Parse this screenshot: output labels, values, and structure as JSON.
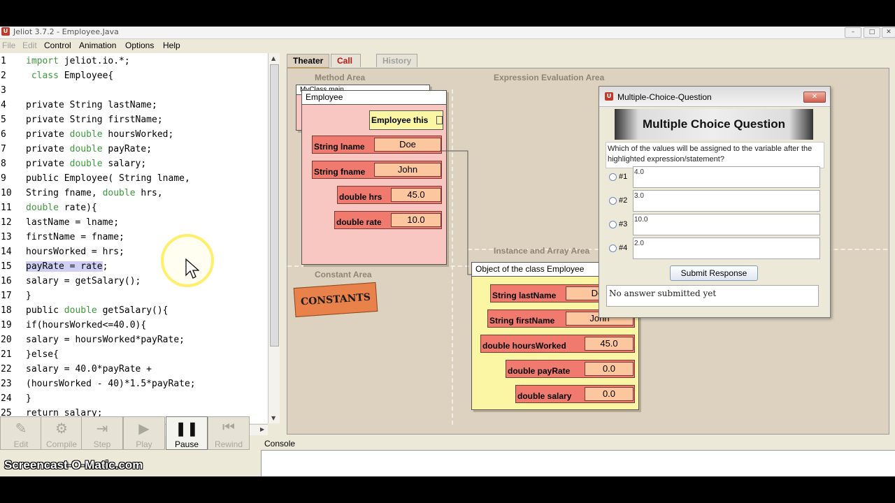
{
  "window": {
    "title": "Jeliot 3.7.2 - Employee.Java",
    "logo": "U",
    "controls": [
      "–",
      "□",
      "✕"
    ]
  },
  "menu": {
    "items": [
      {
        "label": "File",
        "enabled": false
      },
      {
        "label": "Edit",
        "enabled": false
      },
      {
        "label": "Control",
        "enabled": true
      },
      {
        "label": "Animation",
        "enabled": true
      },
      {
        "label": "Options",
        "enabled": true
      },
      {
        "label": "Help",
        "enabled": true
      }
    ]
  },
  "editor": {
    "lines": [
      {
        "n": "1",
        "parts": [
          {
            "t": "import",
            "c": "kw"
          },
          {
            "t": " jeliot.io.*;"
          }
        ]
      },
      {
        "n": "2",
        "parts": [
          {
            "t": " "
          },
          {
            "t": "class",
            "c": "kw"
          },
          {
            "t": " Employee{"
          }
        ]
      },
      {
        "n": "3",
        "parts": [
          {
            "t": ""
          }
        ]
      },
      {
        "n": "4",
        "parts": [
          {
            "t": "private String lastName;"
          }
        ]
      },
      {
        "n": "5",
        "parts": [
          {
            "t": "private String firstName;"
          }
        ]
      },
      {
        "n": "6",
        "parts": [
          {
            "t": "private "
          },
          {
            "t": "double",
            "c": "kw"
          },
          {
            "t": " hoursWorked;"
          }
        ]
      },
      {
        "n": "7",
        "parts": [
          {
            "t": "private "
          },
          {
            "t": "double",
            "c": "kw"
          },
          {
            "t": " payRate;"
          }
        ]
      },
      {
        "n": "8",
        "parts": [
          {
            "t": "private "
          },
          {
            "t": "double",
            "c": "kw"
          },
          {
            "t": " salary;"
          }
        ]
      },
      {
        "n": "9",
        "parts": [
          {
            "t": "public Employee( String lname,"
          }
        ]
      },
      {
        "n": "10",
        "parts": [
          {
            "t": "String fname, "
          },
          {
            "t": "double",
            "c": "kw"
          },
          {
            "t": " hrs,"
          }
        ]
      },
      {
        "n": "11",
        "parts": [
          {
            "t": "double",
            "c": "kw"
          },
          {
            "t": " rate){"
          }
        ]
      },
      {
        "n": "12",
        "parts": [
          {
            "t": "lastName = lname;"
          }
        ]
      },
      {
        "n": "13",
        "parts": [
          {
            "t": "firstName = fname;"
          }
        ]
      },
      {
        "n": "14",
        "parts": [
          {
            "t": "hoursWorked = hrs;"
          }
        ]
      },
      {
        "n": "15",
        "parts": [
          {
            "t": "payRate = rate",
            "c": "hl"
          },
          {
            "t": ";"
          }
        ]
      },
      {
        "n": "16",
        "parts": [
          {
            "t": "salary = getSalary();"
          }
        ]
      },
      {
        "n": "17",
        "parts": [
          {
            "t": "}"
          }
        ]
      },
      {
        "n": "18",
        "parts": [
          {
            "t": "public "
          },
          {
            "t": "double",
            "c": "kw"
          },
          {
            "t": " getSalary(){"
          }
        ]
      },
      {
        "n": "19",
        "parts": [
          {
            "t": "if(hoursWorked<=40.0){"
          }
        ]
      },
      {
        "n": "20",
        "parts": [
          {
            "t": "salary = hoursWorked*payRate;"
          }
        ]
      },
      {
        "n": "21",
        "parts": [
          {
            "t": "}else{"
          }
        ]
      },
      {
        "n": "22",
        "parts": [
          {
            "t": "salary = 40.0*payRate +"
          }
        ]
      },
      {
        "n": "23",
        "parts": [
          {
            "t": "(hoursWorked - 40)*1.5*payRate;"
          }
        ]
      },
      {
        "n": "24",
        "parts": [
          {
            "t": "}"
          }
        ]
      },
      {
        "n": "25",
        "parts": [
          {
            "t": "return salary;"
          }
        ]
      }
    ]
  },
  "tabs": [
    {
      "label": "Theater",
      "state": "active"
    },
    {
      "label": "Call Tree",
      "state": "normal"
    },
    {
      "label": "History",
      "state": "disabled"
    }
  ],
  "theater": {
    "method_area": "Method Area",
    "expression_area": "Expression Evaluation Area",
    "constant_area": "Constant Area",
    "instance_area": "Instance and Array Area",
    "back_frame_title": "MyClass.main",
    "frame_title": "Employee",
    "this_label": "Employee this",
    "frame_vars": [
      {
        "name": "String lname",
        "value": "Doe"
      },
      {
        "name": "String fname",
        "value": "John"
      },
      {
        "name": "double hrs",
        "value": "45.0"
      },
      {
        "name": "double rate",
        "value": "10.0"
      }
    ],
    "constants_label": "CONSTANTS",
    "object_title": "Object of the class Employee",
    "object_fields": [
      {
        "name": "String lastName",
        "value": "Doe"
      },
      {
        "name": "String firstName",
        "value": "John"
      },
      {
        "name": "double hoursWorked",
        "value": "45.0"
      },
      {
        "name": "double payRate",
        "value": "0.0"
      },
      {
        "name": "double salary",
        "value": "0.0"
      }
    ]
  },
  "dialog": {
    "title": "Multiple-Choice-Question",
    "header": "Multiple Choice Question",
    "question": "Which of the values will be assigned to the variable after the highlighted expression/statement?",
    "options": [
      {
        "num": "#1",
        "value": "4.0"
      },
      {
        "num": "#2",
        "value": "3.0"
      },
      {
        "num": "#3",
        "value": "10.0"
      },
      {
        "num": "#4",
        "value": "2.0"
      }
    ],
    "submit_label": "Submit Response",
    "status": "No answer submitted yet"
  },
  "controls": {
    "buttons": [
      {
        "label": "Edit",
        "icon": "edit-icon",
        "enabled": false
      },
      {
        "label": "Compile",
        "icon": "compile-icon",
        "enabled": false
      },
      {
        "label": "Step",
        "icon": "step-icon",
        "enabled": false
      },
      {
        "label": "Play",
        "icon": "play-icon",
        "enabled": false
      },
      {
        "label": "Pause",
        "icon": "pause-icon",
        "enabled": true
      },
      {
        "label": "Rewind",
        "icon": "rewind-icon",
        "enabled": false
      }
    ],
    "console_label": "Console"
  },
  "watermark": "Screencast-O-Matic.com"
}
